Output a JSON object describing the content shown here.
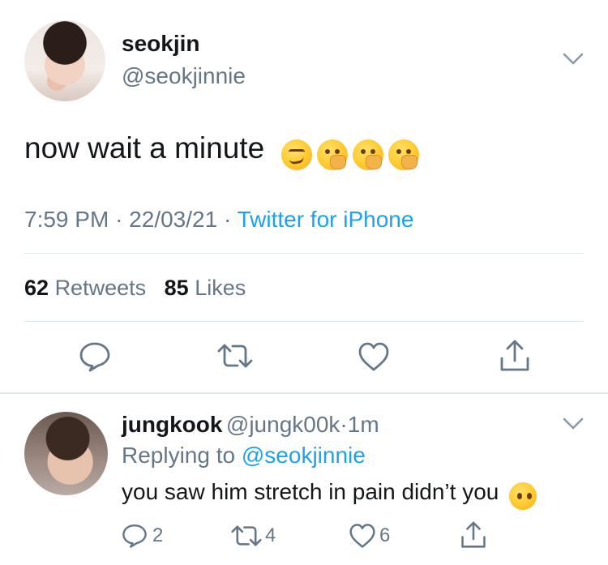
{
  "tweet": {
    "display_name": "seokjin",
    "handle": "@seokjinnie",
    "text": "now wait a minute",
    "emojis": [
      "smirking-face",
      "face-with-hand-over-mouth",
      "face-with-hand-over-mouth",
      "face-with-hand-over-mouth"
    ],
    "time": "7:59 PM",
    "sep1": "·",
    "date": "22/03/21",
    "sep2": "·",
    "source": "Twitter for iPhone",
    "retweets_count": "62",
    "retweets_label": "Retweets",
    "likes_count": "85",
    "likes_label": "Likes"
  },
  "reply": {
    "display_name": "jungkook",
    "handle": "@jungk00k",
    "sep": "·",
    "age": "1m",
    "replying_prefix": "Replying to",
    "replying_to": "@seokjinnie",
    "text": "you saw him stretch in pain didn’t you",
    "emoji": "face-without-mouth",
    "reply_count": "2",
    "retweet_count": "4",
    "like_count": "6"
  },
  "colors": {
    "text": "#14171a",
    "secondary": "#657786",
    "link": "#1da1f2",
    "divider": "#e1e8ed"
  }
}
